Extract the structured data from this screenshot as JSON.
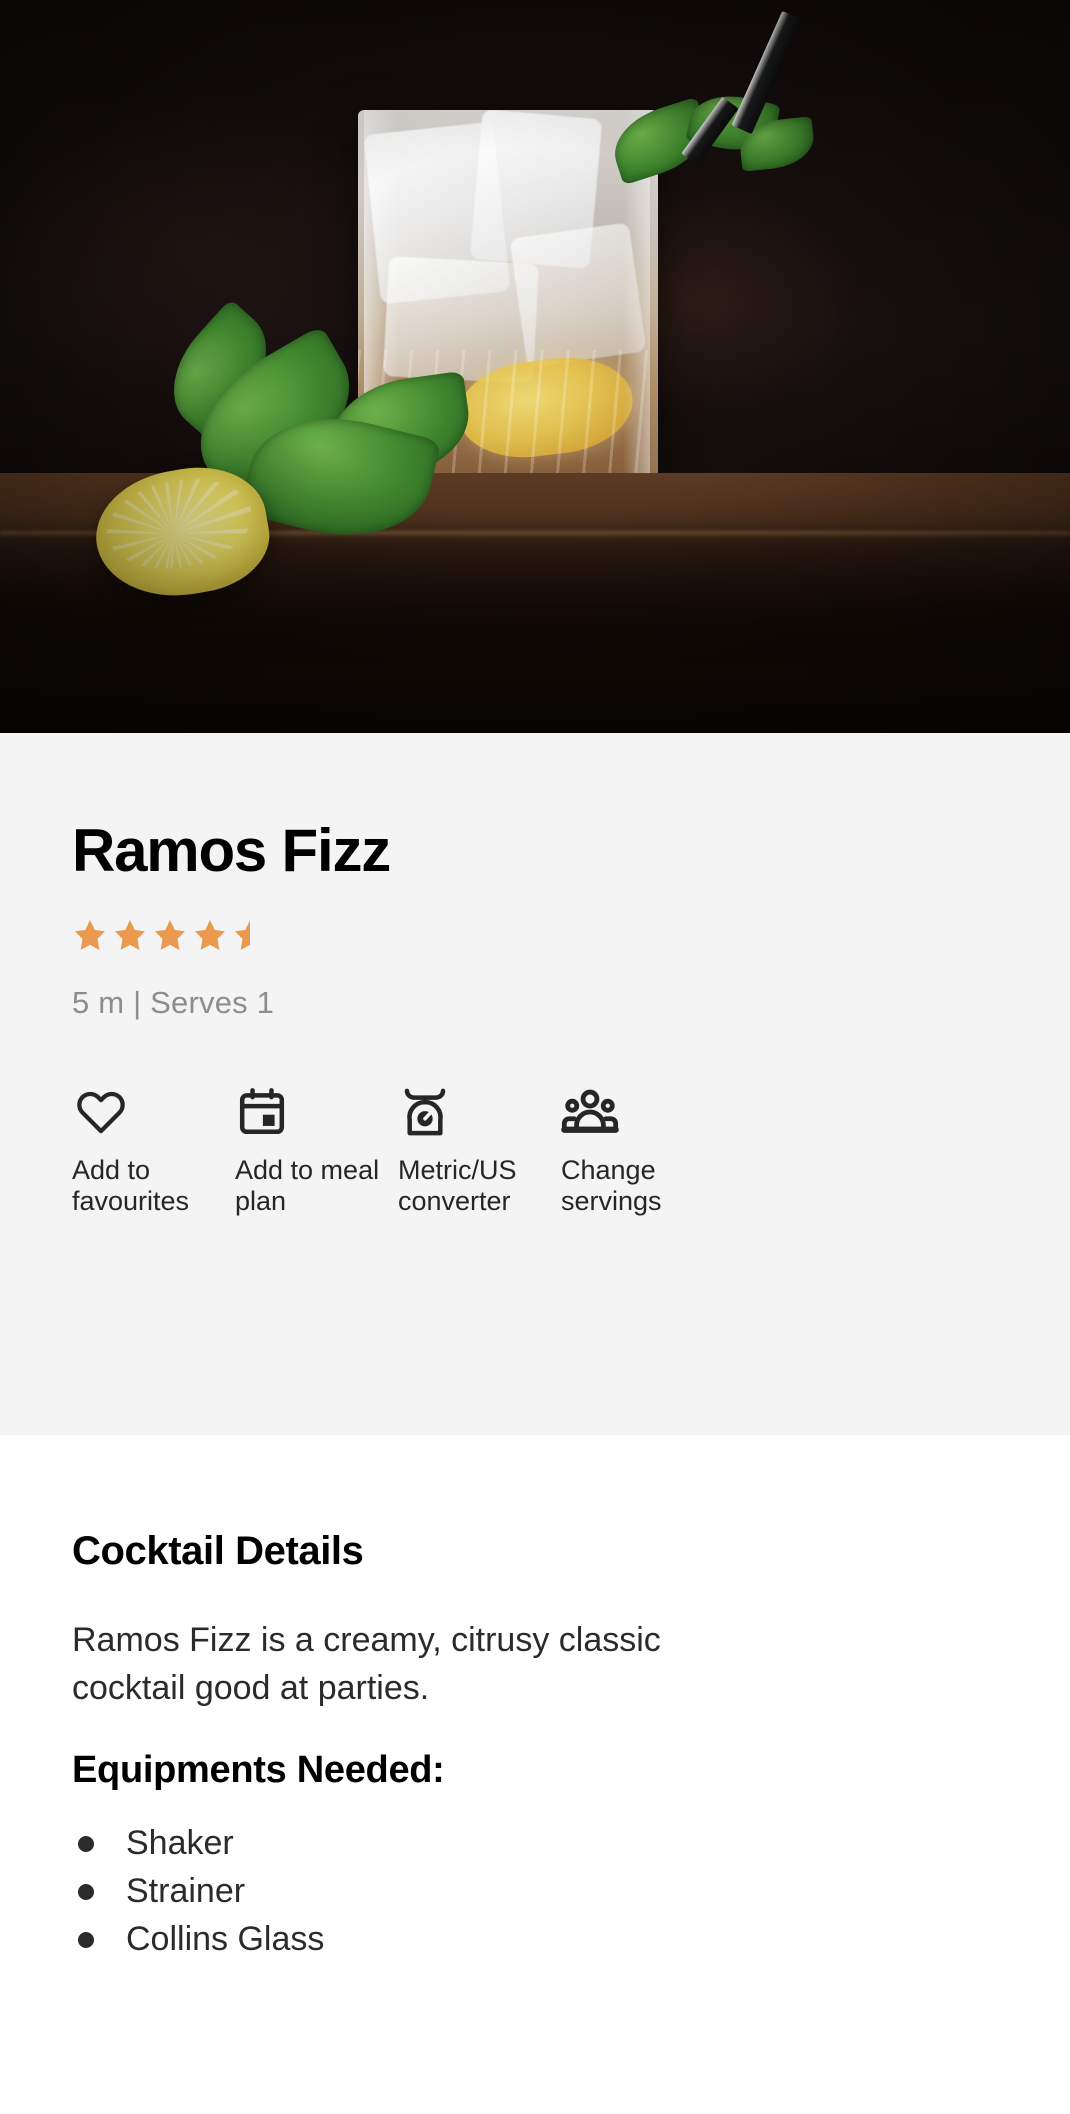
{
  "hero": {
    "alt": "Ramos Fizz cocktail in a tall cut-glass tumbler with ice, lemon slice, mint leaves and a black straw on a dark wooden table"
  },
  "recipe": {
    "title": "Ramos Fizz",
    "rating": {
      "value": 4.5,
      "max": 5,
      "color": "#ea9a4f"
    },
    "meta": "5 m | Serves 1",
    "time": "5 m",
    "servings": "Serves 1"
  },
  "actions": [
    {
      "icon": "heart-icon",
      "label": "Add to favourites"
    },
    {
      "icon": "calendar-icon",
      "label": "Add to meal plan"
    },
    {
      "icon": "scale-icon",
      "label": "Metric/US converter"
    },
    {
      "icon": "people-icon",
      "label": "Change servings"
    }
  ],
  "details": {
    "heading": "Cocktail Details",
    "description": "Ramos Fizz is a creamy, citrusy classic cocktail good at parties.",
    "equipment_heading": "Equipments Needed:",
    "equipment": [
      "Shaker",
      "Strainer",
      "Collins Glass"
    ]
  }
}
